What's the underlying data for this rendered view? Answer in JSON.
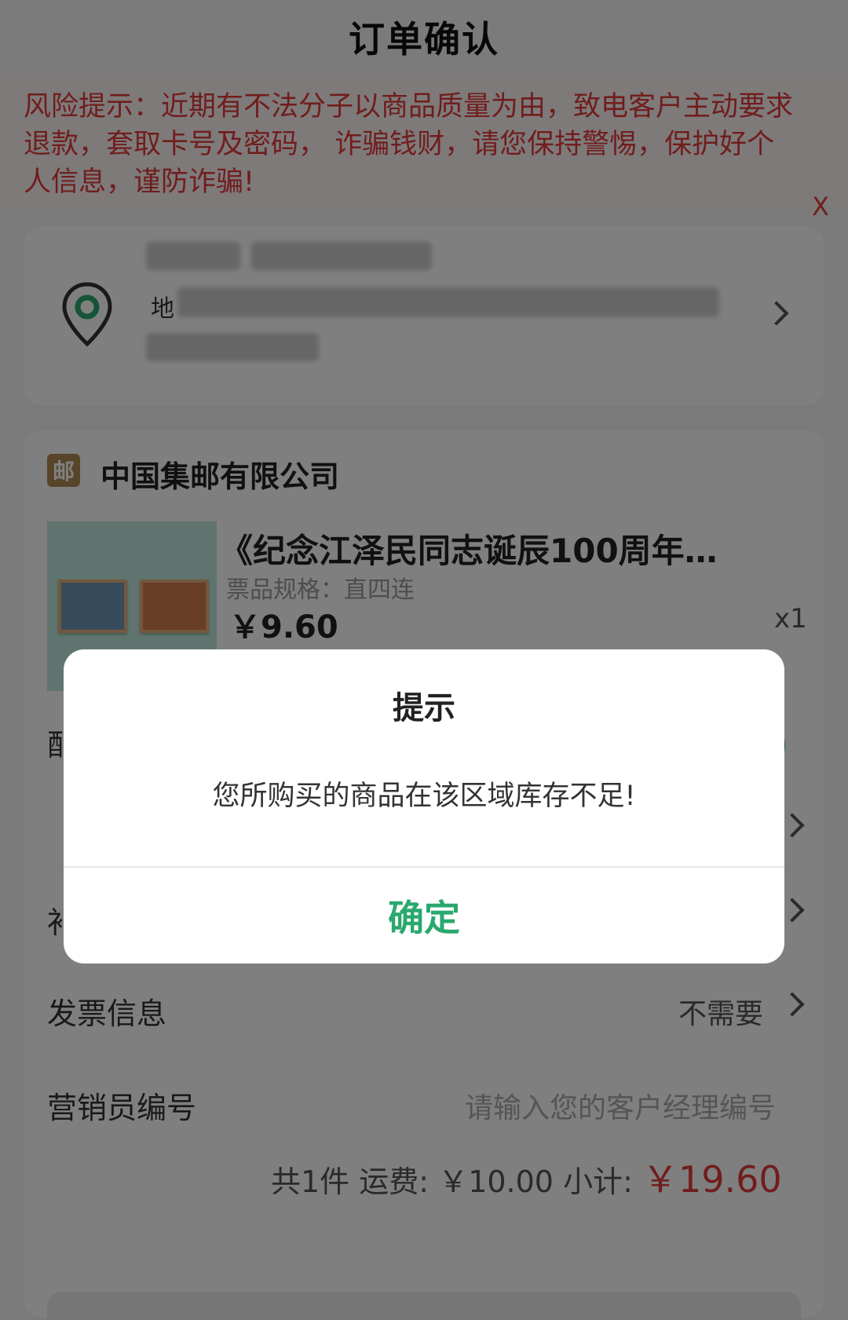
{
  "navbar": {
    "title": "订单确认"
  },
  "risk_notice": {
    "text": "风险提示：近期有不法分子以商品质量为由，致电客户主动要求退款，套取卡号及密码， 诈骗钱财，请您保持警惕，保护好个人信息，谨防诈骗!",
    "close": "X"
  },
  "address": {
    "prefix": "地"
  },
  "shop": {
    "icon_text": "邮",
    "name": "中国集邮有限公司"
  },
  "product": {
    "title": "《纪念江泽民同志诞辰100周年…",
    "spec": "票品规格：直四连",
    "price": "￥9.60",
    "qty": "x1"
  },
  "rows": {
    "partial_1": "配",
    "partial_2": "补",
    "invoice_label": "发票信息",
    "invoice_value": "不需要",
    "marketer_label": "营销员编号",
    "marketer_placeholder": "请输入您的客户经理编号"
  },
  "summary": {
    "count": "共1件",
    "shipping_label": "运费:",
    "shipping": "￥10.00",
    "subtotal_label": "小计:",
    "subtotal": "￥19.60"
  },
  "dialog": {
    "title": "提示",
    "message": "您所购买的商品在该区域库存不足!",
    "confirm": "确定"
  },
  "colors": {
    "accent_green": "#2aa86f",
    "alert_red": "#e23b3b"
  }
}
